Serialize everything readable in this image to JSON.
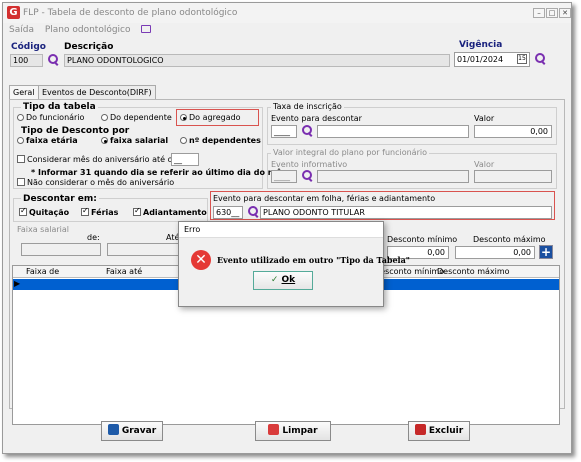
{
  "window": {
    "title": "FLP - Tabela de desconto de plano odontológico",
    "app_logo": "G"
  },
  "menu": {
    "exit": "Saída",
    "plan": "Plano odontológico"
  },
  "header": {
    "codigo_label": "Código",
    "codigo_value": "100",
    "descricao_label": "Descrição",
    "descricao_value": "PLANO ODONTOLOGICO",
    "vigencia_label": "Vigência",
    "vigencia_value": "01/01/2024"
  },
  "tabs": [
    "Geral",
    "Eventos de Desconto(DIRF)"
  ],
  "tipo_tabela": {
    "label": "Tipo da tabela",
    "options": [
      "Do funcionário",
      "Do dependente",
      "Do agregado"
    ],
    "selected": 2
  },
  "tipo_desconto": {
    "label": "Tipo de Desconto por",
    "options": [
      "faixa etária",
      "faixa salarial",
      "nº dependentes"
    ],
    "selected": 1
  },
  "aniversario": {
    "considerar": "Considerar mês do aniversário até o dia",
    "considerar_value": "__",
    "informar": "* Informar 31 quando dia se referir ao último dia do mês",
    "nao_considerar": "Não considerar o mês do aniversário"
  },
  "descontar": {
    "label": "Descontar em:",
    "options": [
      "Quitação",
      "Férias",
      "Adiantamento"
    ]
  },
  "taxa": {
    "label": "Taxa de inscrição",
    "evento_label": "Evento para descontar",
    "evento_value": "____",
    "valor_label": "Valor",
    "valor_value": "0,00"
  },
  "valor_integral": {
    "label": "Valor integral do plano por funcionário",
    "evento_label": "Evento informativo",
    "evento_value": "____",
    "valor_label": "Valor"
  },
  "evento_folha": {
    "label": "Evento para descontar em folha, férias e adiantamento",
    "code": "630__",
    "desc": "PLANO ODONTO TITULAR"
  },
  "faixa_salarial": {
    "label": "Faixa salarial",
    "de_label": "de:",
    "ate_label": "Até:",
    "desc_min_label": "Desconto mínimo",
    "desc_min_value": "0,00",
    "desc_max_label": "Desconto máximo",
    "desc_max_value": "0,00",
    "add": "+"
  },
  "grid": {
    "columns": [
      "Faixa de",
      "Faixa até",
      "Desconto mínimo",
      "Desconto máximo"
    ]
  },
  "buttons": {
    "gravar": "Gravar",
    "limpar": "Limpar",
    "excluir": "Excluir"
  },
  "dialog": {
    "title": "Erro",
    "message": "Evento utilizado em outro \"Tipo da Tabela\"",
    "ok": "Ok",
    "ok_check": "✓",
    "error_glyph": "✕"
  },
  "colors": {
    "accent": "#1a237e",
    "selection": "#0060d0",
    "error": "#e53935",
    "highlight": "#d9534f"
  }
}
